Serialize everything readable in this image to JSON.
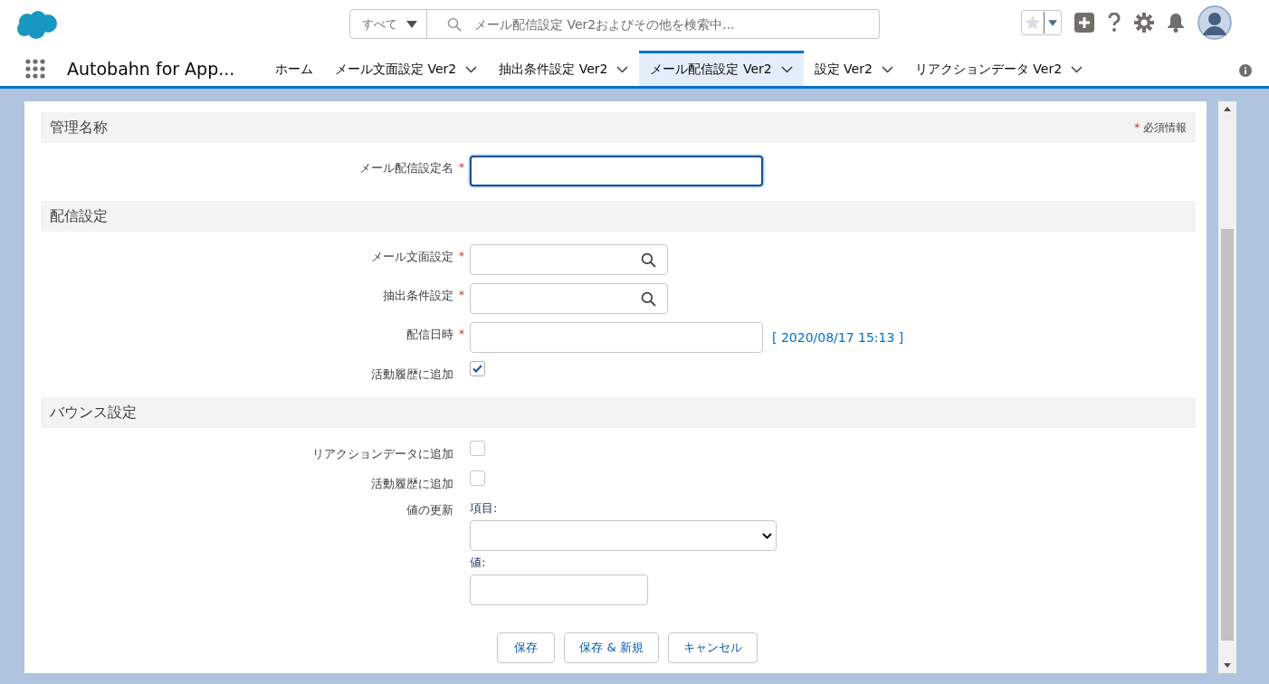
{
  "header": {
    "search_scope": "すべて",
    "search_placeholder": "メール配信設定 Ver2およびその他を検索中..."
  },
  "nav": {
    "app_name": "Autobahn for App...",
    "tabs": [
      {
        "label": "ホーム",
        "selected": false,
        "dropdown": false
      },
      {
        "label": "メール文面設定 Ver2",
        "selected": false,
        "dropdown": true
      },
      {
        "label": "抽出条件設定 Ver2",
        "selected": false,
        "dropdown": true
      },
      {
        "label": "メール配信設定 Ver2",
        "selected": true,
        "dropdown": true
      },
      {
        "label": "設定 Ver2",
        "selected": false,
        "dropdown": true
      },
      {
        "label": "リアクションデータ Ver2",
        "selected": false,
        "dropdown": true
      }
    ]
  },
  "form": {
    "required_mark": "*",
    "required_note": "必須情報",
    "sections": [
      {
        "title": "管理名称",
        "fields": [
          {
            "kind": "text",
            "label": "メール配信設定名",
            "required": true,
            "focused": true
          }
        ]
      },
      {
        "title": "配信設定",
        "fields": [
          {
            "kind": "lookup",
            "label": "メール文面設定",
            "required": true
          },
          {
            "kind": "lookup",
            "label": "抽出条件設定",
            "required": true
          },
          {
            "kind": "datetime",
            "label": "配信日時",
            "required": true,
            "hint": "[ 2020/08/17 15:13 ]"
          },
          {
            "kind": "checkbox",
            "label": "活動履歴に追加",
            "required": false,
            "checked": true
          }
        ]
      },
      {
        "title": "バウンス設定",
        "fields": [
          {
            "kind": "checkbox",
            "label": "リアクションデータに追加",
            "required": false,
            "checked": false
          },
          {
            "kind": "checkbox",
            "label": "活動履歴に追加",
            "required": false,
            "checked": false
          },
          {
            "kind": "update",
            "label": "値の更新",
            "required": false,
            "item_label": "項目:",
            "value_label": "値:"
          }
        ]
      }
    ],
    "buttons": [
      "保存",
      "保存 & 新規",
      "キャンセル"
    ]
  }
}
